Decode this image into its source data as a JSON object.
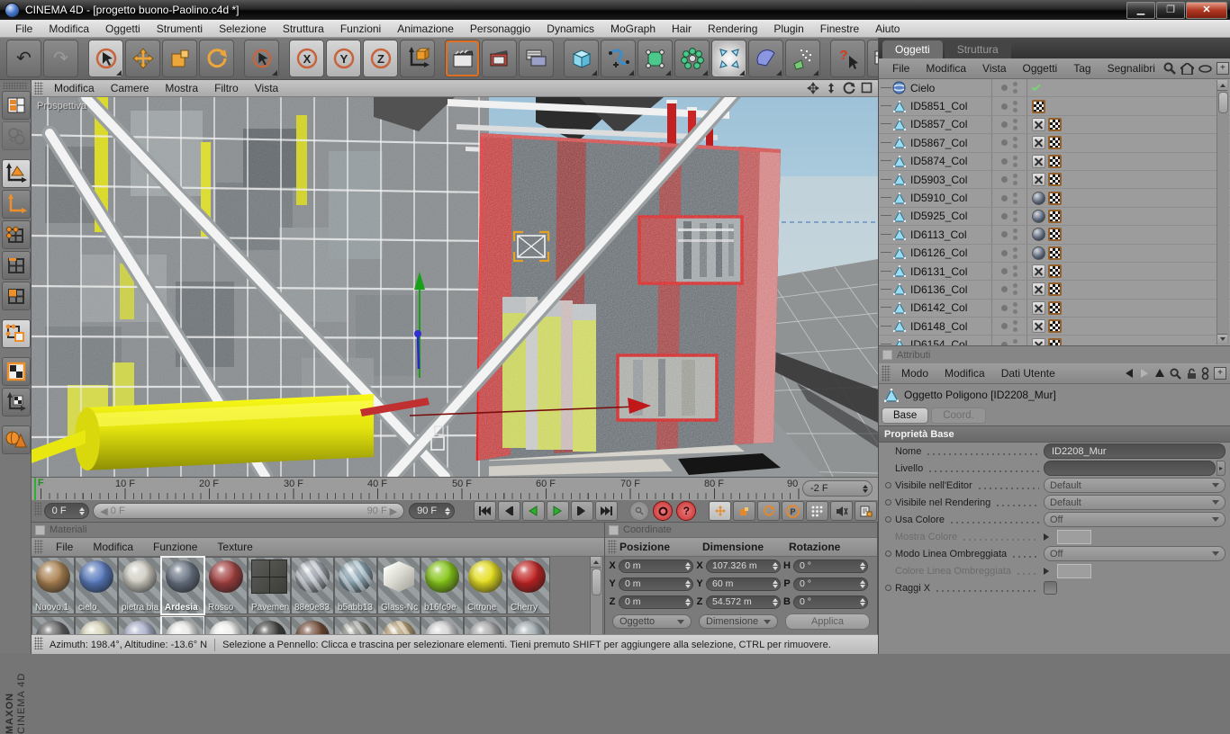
{
  "window": {
    "title": "CINEMA 4D - [progetto buono-Paolino.c4d *]"
  },
  "menubar": {
    "items": [
      "File",
      "Modifica",
      "Oggetti",
      "Strumenti",
      "Selezione",
      "Struttura",
      "Funzioni",
      "Animazione",
      "Personaggio",
      "Dynamics",
      "MoGraph",
      "Hair",
      "Rendering",
      "Plugin",
      "Finestre",
      "Aiuto"
    ]
  },
  "toolbar": {
    "axis_locks": [
      "X",
      "Y",
      "Z"
    ],
    "icons": [
      "undo",
      "redo",
      "live-selection",
      "move",
      "scale",
      "rotate",
      "selection",
      "lock-x",
      "lock-y",
      "lock-z",
      "coordinate-system",
      "render-view",
      "render-settings",
      "render-queue",
      "primitive-cube",
      "spline",
      "generator",
      "array",
      "deformer",
      "environment",
      "particles",
      "help",
      "commander",
      "browser"
    ]
  },
  "sidebar": {
    "icons": [
      "layout",
      "convert",
      "model-mode",
      "object-axis-mode",
      "points-mode",
      "edges-mode",
      "polygons-mode",
      "texture-mode",
      "uv-checker",
      "texture-axis-mode",
      "simulation"
    ]
  },
  "viewport": {
    "menu": [
      "Modifica",
      "Camere",
      "Mostra",
      "Filtro",
      "Vista"
    ],
    "camera_label": "Prospettiva",
    "nav_icons": [
      "pan",
      "dolly",
      "orbit",
      "maximize"
    ]
  },
  "object_manager": {
    "tabs": [
      "Oggetti",
      "Struttura"
    ],
    "menu": [
      "File",
      "Modifica",
      "Vista",
      "Oggetti",
      "Tag",
      "Segnalibri"
    ],
    "objects": [
      {
        "name": "Cielo",
        "icon": "sky",
        "tags": [
          "check"
        ]
      },
      {
        "name": "ID5851_Col",
        "icon": "polygon",
        "tags": [
          "checker"
        ]
      },
      {
        "name": "ID5857_Col",
        "icon": "polygon",
        "tags": [
          "x",
          "checker"
        ]
      },
      {
        "name": "ID5867_Col",
        "icon": "polygon",
        "tags": [
          "x",
          "checker"
        ]
      },
      {
        "name": "ID5874_Col",
        "icon": "polygon",
        "tags": [
          "x",
          "checker"
        ]
      },
      {
        "name": "ID5903_Col",
        "icon": "polygon",
        "tags": [
          "x",
          "checker"
        ]
      },
      {
        "name": "ID5910_Col",
        "icon": "polygon",
        "tags": [
          "sphere",
          "checker"
        ]
      },
      {
        "name": "ID5925_Col",
        "icon": "polygon",
        "tags": [
          "sphere",
          "checker"
        ]
      },
      {
        "name": "ID6113_Col",
        "icon": "polygon",
        "tags": [
          "sphere",
          "checker"
        ]
      },
      {
        "name": "ID6126_Col",
        "icon": "polygon",
        "tags": [
          "sphere",
          "checker"
        ]
      },
      {
        "name": "ID6131_Col",
        "icon": "polygon",
        "tags": [
          "x",
          "checker"
        ]
      },
      {
        "name": "ID6136_Col",
        "icon": "polygon",
        "tags": [
          "x",
          "checker"
        ]
      },
      {
        "name": "ID6142_Col",
        "icon": "polygon",
        "tags": [
          "x",
          "checker"
        ]
      },
      {
        "name": "ID6148_Col",
        "icon": "polygon",
        "tags": [
          "x",
          "checker"
        ]
      },
      {
        "name": "ID6154_Col",
        "icon": "polygon",
        "tags": [
          "x",
          "checker"
        ]
      }
    ]
  },
  "attributes": {
    "panel_title": "Attributi",
    "menu": [
      "Modo",
      "Modifica",
      "Dati Utente"
    ],
    "object_title": "Oggetto Poligono [ID2208_Mur]",
    "tabs": [
      "Base",
      "Coord."
    ],
    "section": "Proprietà Base",
    "nome_label": "Nome",
    "nome_value": "ID2208_Mur",
    "livello_label": "Livello",
    "vis_editor_label": "Visibile nell'Editor",
    "vis_editor_value": "Default",
    "vis_render_label": "Visibile nel Rendering",
    "vis_render_value": "Default",
    "usa_colore_label": "Usa Colore",
    "usa_colore_value": "Off",
    "mostra_colore_label": "Mostra Colore",
    "modo_linea_label": "Modo Linea Ombreggiata",
    "modo_linea_value": "Off",
    "colore_linea_label": "Colore Linea Ombreggiata",
    "raggi_label": "Raggi X"
  },
  "timeline": {
    "ticks": [
      "10 F",
      "20 F",
      "30 F",
      "40 F",
      "50 F",
      "60 F",
      "70 F",
      "80 F",
      "90 F"
    ],
    "playhead_label": "F",
    "current_frame": "-2 F",
    "range_start": "0 F",
    "range_end": "90 F",
    "slider_min": "0 F",
    "slider_max": "90 F",
    "param_label": "P"
  },
  "materials": {
    "title": "Materiali",
    "menu": [
      "File",
      "Modifica",
      "Funzione",
      "Texture"
    ],
    "items": [
      {
        "name": "Nuovo.1",
        "color": "#a97f4e"
      },
      {
        "name": "cielo",
        "color": "#5577bb"
      },
      {
        "name": "pietra bia",
        "color": "#cfccc2"
      },
      {
        "name": "Ardesia",
        "color": "#667080",
        "selected": true
      },
      {
        "name": "Rosso",
        "color": "#a03c3c"
      },
      {
        "name": "Pavemen",
        "color": "#4c4c48",
        "style": "tile"
      },
      {
        "name": "88e0e83",
        "color": "#a9afb9",
        "style": "striped"
      },
      {
        "name": "b5abb13",
        "color": "#93aebc",
        "style": "striped"
      },
      {
        "name": "Glass-Nc",
        "color": "#dddcd6",
        "style": "cube"
      },
      {
        "name": "b16fc9e",
        "color": "#84c515"
      },
      {
        "name": "Citrone",
        "color": "#e5de1d"
      },
      {
        "name": "Cherry",
        "color": "#c01f1f"
      }
    ],
    "row2_colors": [
      "#5c5c5c",
      "#d9d5b9",
      "#a9aec9",
      "#e8e8e6",
      "#efefec",
      "#3c3c3a",
      "#6e4530",
      "#8e8e88",
      "#c3a97b",
      "#d2d2d2",
      "#a7a7a7",
      "#9fa9ae"
    ]
  },
  "coordinates": {
    "title": "Coordinate",
    "headers": [
      "Posizione",
      "Dimensione",
      "Rotazione"
    ],
    "pos_x_label": "X",
    "pos_x": "0 m",
    "pos_y_label": "Y",
    "pos_y": "0 m",
    "pos_z_label": "Z",
    "pos_z": "0 m",
    "dim_x_label": "X",
    "dim_x": "107.326 m",
    "dim_y_label": "Y",
    "dim_y": "60 m",
    "dim_z_label": "Z",
    "dim_z": "54.572 m",
    "rot_h_label": "H",
    "rot_h": "0 °",
    "rot_p_label": "P",
    "rot_p": "0 °",
    "rot_b_label": "B",
    "rot_b": "0 °",
    "mode_object": "Oggetto",
    "mode_dimension": "Dimensione",
    "apply": "Applica"
  },
  "statusbar": {
    "angles": "Azimuth: 198.4°, Altitudine: -13.6°  N",
    "hint": "Selezione a Pennello: Clicca e trascina per selezionare elementi. Tieni premuto SHIFT per aggiungere alla selezione, CTRL per rimuovere."
  },
  "branding": {
    "line1": "MAXON",
    "line2": "CINEMA 4D"
  },
  "colors": {
    "accent_orange": "#e8862a",
    "selection_red": "#cc2222",
    "play_green": "#2fae2f",
    "sky_blue": "#9dc2d8"
  }
}
